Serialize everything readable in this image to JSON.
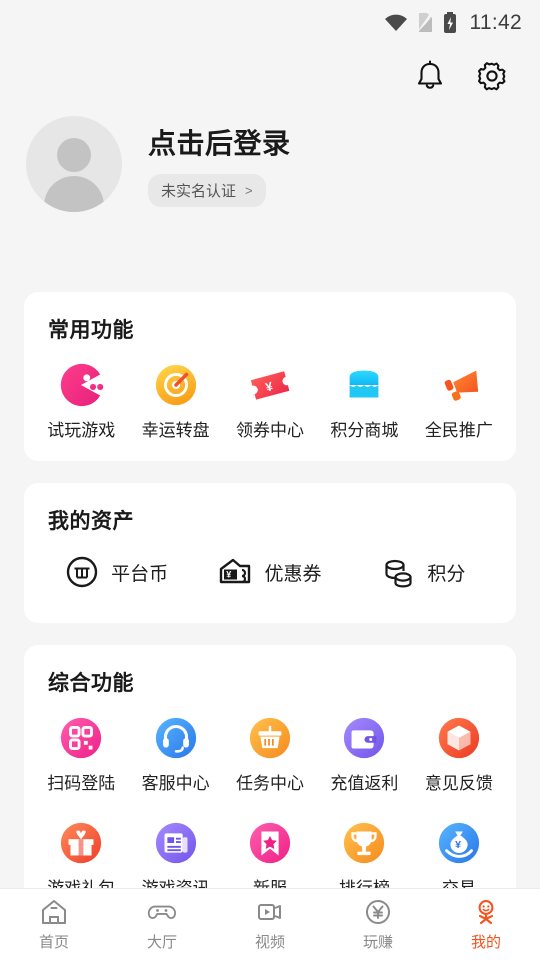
{
  "statusbar": {
    "time": "11:42",
    "wifi_icon": "wifi-icon",
    "sim_icon": "sim-card-off-icon",
    "battery_icon": "battery-charging-icon"
  },
  "topbar": {
    "notification_label": "bell-icon",
    "settings_label": "gear-icon"
  },
  "profile": {
    "avatar_icon": "default-avatar-icon",
    "name": "点击后登录",
    "badge_text": "未实名认证",
    "badge_chevron": ">"
  },
  "common": {
    "title": "常用功能",
    "items": [
      {
        "label": "试玩游戏",
        "icon": "pacman-icon",
        "color": "#f5347f"
      },
      {
        "label": "幸运转盘",
        "icon": "target-wheel-icon",
        "color": "#fcc020"
      },
      {
        "label": "领券中心",
        "icon": "coupon-ticket-icon",
        "color": "#f44040"
      },
      {
        "label": "积分商城",
        "icon": "shop-store-icon",
        "color": "#22c8f5"
      },
      {
        "label": "全民推广",
        "icon": "megaphone-icon",
        "color": "#f9701a"
      }
    ]
  },
  "assets": {
    "title": "我的资产",
    "items": [
      {
        "label": "平台币",
        "icon": "platform-coin-icon"
      },
      {
        "label": "优惠券",
        "icon": "coupon-wallet-icon"
      },
      {
        "label": "积分",
        "icon": "points-stack-icon"
      }
    ]
  },
  "comprehensive": {
    "title": "综合功能",
    "row1": [
      {
        "label": "扫码登陆",
        "icon": "qr-scan-icon",
        "color": "#f5419a"
      },
      {
        "label": "客服中心",
        "icon": "headset-support-icon",
        "color": "#3b8ef0"
      },
      {
        "label": "任务中心",
        "icon": "task-basket-icon",
        "color": "#f6a62a"
      },
      {
        "label": "充值返利",
        "icon": "wallet-rebate-icon",
        "color": "#8b6cf0"
      },
      {
        "label": "意见反馈",
        "icon": "feedback-box-icon",
        "color": "#f0502f"
      }
    ],
    "row2": [
      {
        "label": "游戏礼包",
        "icon": "gift-box-icon",
        "color": "#f0602f"
      },
      {
        "label": "游戏资讯",
        "icon": "news-document-icon",
        "color": "#8b6cf0"
      },
      {
        "label": "新服",
        "icon": "bookmark-star-icon",
        "color": "#f5419a"
      },
      {
        "label": "排行榜",
        "icon": "trophy-icon",
        "color": "#f6a62a"
      },
      {
        "label": "交易",
        "icon": "trade-money-icon",
        "color": "#3b8ef0"
      }
    ]
  },
  "tabbar": {
    "active_color": "#f4541f",
    "items": [
      {
        "label": "首页",
        "icon": "home-icon",
        "active": false
      },
      {
        "label": "大厅",
        "icon": "gamepad-icon",
        "active": false
      },
      {
        "label": "视频",
        "icon": "video-icon",
        "active": false
      },
      {
        "label": "玩赚",
        "icon": "yen-circle-icon",
        "active": false
      },
      {
        "label": "我的",
        "icon": "profile-face-icon",
        "active": true
      }
    ]
  }
}
